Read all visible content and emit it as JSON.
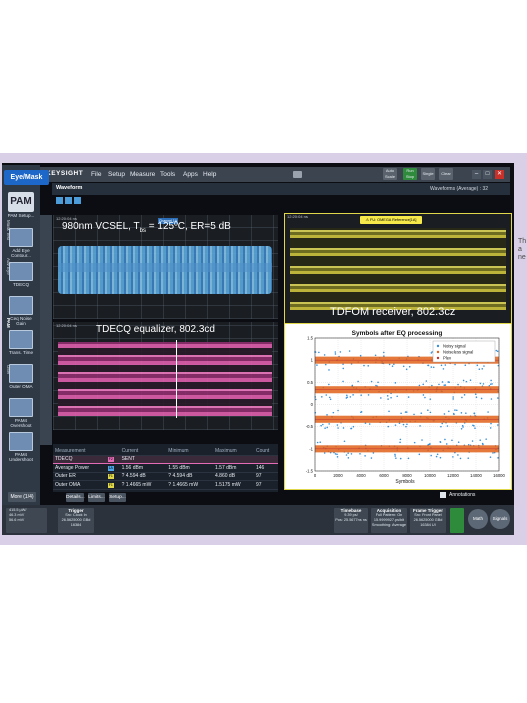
{
  "side_text": {
    "line1": "Th",
    "line2": "a",
    "line3": "ne"
  },
  "app": {
    "brand": "KEYSIGHT",
    "menu": [
      "File",
      "Setup",
      "Measure",
      "Tools",
      "Apps",
      "Help"
    ],
    "toolbar_buttons": [
      "Auto Scale",
      "Run Stop",
      "Single",
      "Clear"
    ],
    "mode_button": "Eye/Mask",
    "pam_logo": "PAM",
    "pam_setup": "PAM Setup...",
    "tabs_label": "Waveform",
    "waveform_info": "Waveforms (Average) : 32"
  },
  "left_tools": [
    {
      "label": "Add Eye Contour..."
    },
    {
      "label": "TDECQ"
    },
    {
      "label": "Ceq Noise Gain"
    },
    {
      "label": "Trans. Time"
    },
    {
      "label": "Outer OMA"
    },
    {
      "label": "PAM4 Overshoot"
    },
    {
      "label": "PAM4 Undershoot"
    }
  ],
  "more_button": "More (1/4)",
  "vertical_tabs": [
    "Mask Test",
    "Adv Eye",
    "PAM",
    "User",
    "Eye Meas"
  ],
  "panes": {
    "blue": {
      "title_pre": "980nm VCSEL, T",
      "title_sub": "bs",
      "title_post": " = 125ºC, ER=5 dB",
      "tag": "Channel 1A",
      "timestamp": "12:20:04 ns"
    },
    "pink": {
      "title": "TDECQ equalizer, 802.3cd",
      "timestamp": "12:20:04 ns"
    },
    "yellow": {
      "title": "TDFOM receiver, 802.3cz",
      "badge": "⚠ FU: OMEGA Reference[1A]",
      "timestamp": "12:20:04 ns"
    }
  },
  "measurements": {
    "headers": [
      "Measurement",
      "",
      "Current",
      "Minimum",
      "Maximum",
      "Count"
    ],
    "rows": [
      {
        "name": "TDECQ",
        "chip": "F2",
        "chip_color": "#e46cb6",
        "current": "SENT",
        "minimum": "",
        "maximum": "",
        "count": ""
      },
      {
        "name": "Average Power",
        "chip": "1A",
        "chip_color": "#4ea6e8",
        "current": "1.56 dBm",
        "minimum": "1.55 dBm",
        "maximum": "1.57 dBm",
        "count": "146"
      },
      {
        "name": "Outer ER",
        "chip": "F1",
        "chip_color": "#e0d84a",
        "current": "? 4.594 dB",
        "minimum": "? 4.594 dB",
        "maximum": "4.860 dB",
        "count": "97"
      },
      {
        "name": "Outer OMA",
        "chip": "F1",
        "chip_color": "#e0d84a",
        "current": "? 1.4665 mW",
        "minimum": "? 1.4665 mW",
        "maximum": "1.5175 mW",
        "count": "97"
      }
    ]
  },
  "detail_buttons": [
    "Details...",
    "Limits...",
    "Setup..."
  ],
  "annotations_label": "Annotations",
  "bottom": {
    "readouts": [
      "415.5 μW/",
      "46.3 mV/",
      "56.6 mV/"
    ],
    "trigger": {
      "title": "Trigger",
      "lines": [
        "Src: Clock In",
        "26.5625000 GBd",
        "16384"
      ]
    },
    "timebase": {
      "title": "Timebase",
      "lines": [
        "9.39 ps/",
        "Pos: 25.5677ns ns"
      ]
    },
    "acquisition": {
      "title": "Acquisition",
      "lines": [
        "Full Pattern: On",
        "15.9999927.ps/bit",
        "Smoothing: Average"
      ]
    },
    "frame_trigger": {
      "title": "Frame Trigger",
      "lines": [
        "Src: Front Panel",
        "26.5625000 GBd",
        "16384 UI"
      ]
    },
    "math": "Math",
    "signals": "Signals"
  },
  "chart_data": {
    "type": "scatter",
    "title": "Symbols after EQ processing",
    "xlabel": "Symbols",
    "ylabel": "",
    "xlim": [
      0,
      16000
    ],
    "ylim": [
      -1.5,
      1.5
    ],
    "xticks": [
      "0",
      "2000",
      "4000",
      "6000",
      "8000",
      "10000",
      "12000",
      "14000",
      "16000"
    ],
    "yticks": [
      "1.5",
      "1",
      "0.5",
      "0",
      "-0.5",
      "-1",
      "-1.5"
    ],
    "grid": true,
    "legend_position": "top-right",
    "series": [
      {
        "name": "Noisy signal",
        "color": "#3a8fd6",
        "levels": [
          1,
          0.333,
          -0.333,
          -1
        ],
        "spread": 0.22
      },
      {
        "name": "Noiseless signal",
        "color": "#e0621a",
        "levels": [
          1,
          0.333,
          -0.333,
          -1
        ],
        "spread": 0.08
      },
      {
        "name": "Plev",
        "color": "#c03030",
        "levels": [
          1,
          0.333,
          -0.333,
          -1
        ],
        "spread": 0
      }
    ]
  }
}
